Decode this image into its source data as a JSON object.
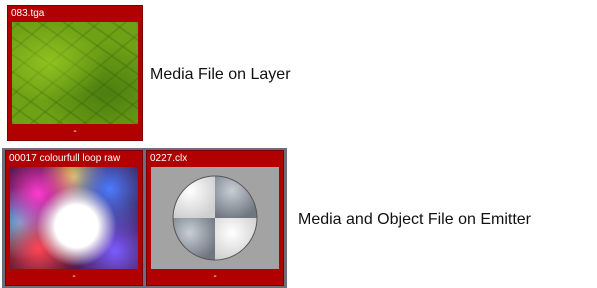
{
  "layer_section": {
    "tile": {
      "title": "083.tga",
      "footer": "-"
    },
    "caption": "Media File on Layer"
  },
  "emitter_section": {
    "tiles": [
      {
        "title": "00017 colourfull loop raw",
        "footer": "-"
      },
      {
        "title": "0227.clx",
        "footer": "-"
      }
    ],
    "caption": "Media and Object File on Emitter"
  },
  "colors": {
    "tile_header": "#b00000",
    "frame": "#6d6d7d",
    "object_bg": "#a3a3a3"
  }
}
